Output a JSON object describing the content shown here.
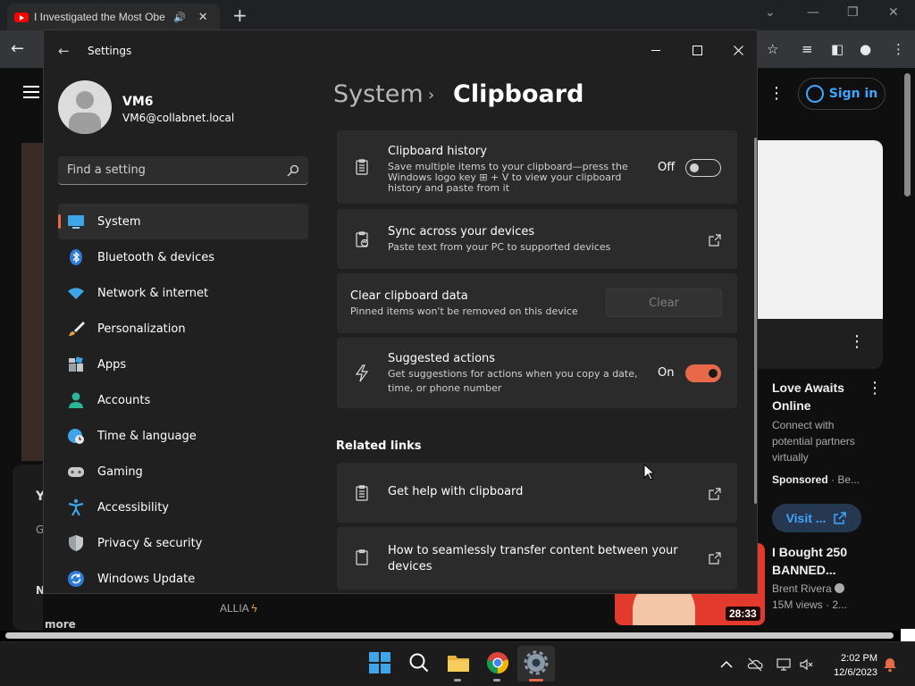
{
  "browser": {
    "tab_title": "I Investigated the Most Obe",
    "sign_in": "Sign in"
  },
  "youtube": {
    "ad_title": "Love Awaits Online",
    "ad_desc": "Connect with potential partners virtually",
    "ad_sponsored": "Sponsored",
    "ad_sponsor_name": " · Be...",
    "ad_visit": "Visit ...",
    "video2_title": "I Bought 250 BANNED...",
    "video2_channel": "Brent Rivera",
    "video2_views": "15M views · 2...",
    "video2_duration": "28:33",
    "left_y": "Y",
    "left_g": "G",
    "left_n": "N",
    "more": "more",
    "desc_fragment": "ALLIA"
  },
  "settings": {
    "window_title": "Settings",
    "user": {
      "name": "VM6",
      "email": "VM6@collabnet.local"
    },
    "search_placeholder": "Find a setting",
    "nav": [
      {
        "label": "System",
        "icon": "system-icon",
        "active": true
      },
      {
        "label": "Bluetooth & devices",
        "icon": "bluetooth-icon"
      },
      {
        "label": "Network & internet",
        "icon": "wifi-icon"
      },
      {
        "label": "Personalization",
        "icon": "brush-icon"
      },
      {
        "label": "Apps",
        "icon": "apps-icon"
      },
      {
        "label": "Accounts",
        "icon": "person-icon"
      },
      {
        "label": "Time & language",
        "icon": "globe-clock-icon"
      },
      {
        "label": "Gaming",
        "icon": "gamepad-icon"
      },
      {
        "label": "Accessibility",
        "icon": "accessibility-icon"
      },
      {
        "label": "Privacy & security",
        "icon": "shield-icon"
      },
      {
        "label": "Windows Update",
        "icon": "update-icon"
      }
    ],
    "breadcrumb": {
      "parent": "System",
      "current": "Clipboard"
    },
    "history": {
      "title": "Clipboard history",
      "desc_line1": "Save multiple items to your clipboard—press the",
      "desc_line2": "Windows logo key ⊞ + V to view your clipboard",
      "desc_line3": "history and paste from it",
      "state_label": "Off",
      "enabled": false
    },
    "sync": {
      "title": "Sync across your devices",
      "desc": "Paste text from your PC to supported devices"
    },
    "clear": {
      "title": "Clear clipboard data",
      "desc": "Pinned items won't be removed on this device",
      "button": "Clear"
    },
    "suggested": {
      "title": "Suggested actions",
      "desc_line1": "Get suggestions for actions when you copy a date,",
      "desc_line2": "time, or phone number",
      "state_label": "On",
      "enabled": true
    },
    "related_heading": "Related links",
    "related": [
      {
        "label": "Get help with clipboard"
      },
      {
        "label_line1": "How to seamlessly transfer content between your",
        "label_line2": "devices"
      }
    ],
    "accent_color": "#e8684a"
  },
  "taskbar": {
    "time": "2:02 PM",
    "date": "12/6/2023",
    "apps": [
      "windows-start-icon",
      "search-icon",
      "file-explorer-icon",
      "chrome-icon",
      "settings-gear-icon"
    ]
  }
}
